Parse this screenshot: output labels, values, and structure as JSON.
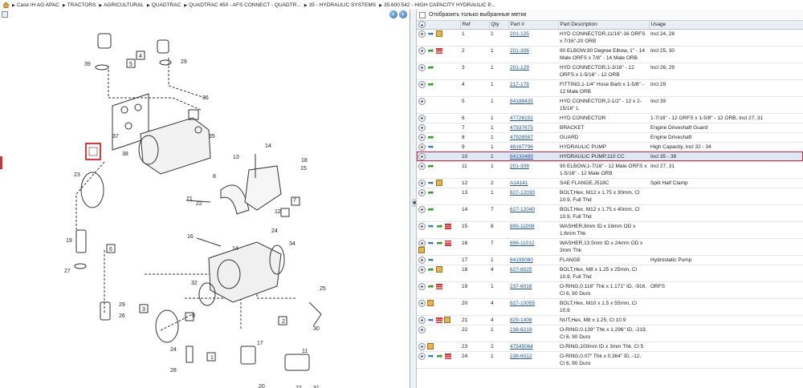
{
  "breadcrumb": [
    "Case IH AG APAC",
    "TRACTORS",
    "AGRICULTURAL",
    "QUADTRAC",
    "QUADTRAC 450 - AFS CONNECT - QUADTR...",
    "35 - HYDRAULIC SYSTEMS",
    "35.600.542 - HIGH CAPACITY HYDRAULIC P..."
  ],
  "filter_label": "Отобразить только выбранные метки",
  "columns": [
    "",
    "Ref",
    "Qty",
    "Part #",
    "Part Description",
    "Usage"
  ],
  "diagram_labels": [
    "39",
    "5",
    "4",
    "29",
    "36",
    "35",
    "37",
    "38",
    "14",
    "13",
    "18",
    "15",
    "7",
    "8",
    "12",
    "24",
    "21",
    "22",
    "23",
    "19",
    "6",
    "27",
    "16",
    "14",
    "34",
    "32",
    "9",
    "29",
    "26",
    "3",
    "2",
    "25",
    "30",
    "17",
    "11",
    "20",
    "24",
    "1",
    "28",
    "27",
    "31"
  ],
  "rows": [
    {
      "icons": [
        "plus",
        "info",
        "box"
      ],
      "ref": "1",
      "qty": "1",
      "part": "201-125",
      "desc": "HYD CONNECTOR,11/16\"-16 ORFS x 7/16\"-20 ORB",
      "usage": "Incl 24, 28"
    },
    {
      "icons": [
        "plus",
        "green",
        "red"
      ],
      "ref": "2",
      "qty": "1",
      "part": "201-306",
      "desc": "90 ELBOW,90 Degree Elbow, 1\" - 14 Male ORFS x 7/8\" - 14 Male ORB",
      "usage": "Incl 25, 30"
    },
    {
      "icons": [
        "plus",
        "green"
      ],
      "ref": "3",
      "qty": "1",
      "part": "201-129",
      "desc": "HYD CONNECTOR,1-3/16\" - 12 ORFS x 1-5/16\" - 12 ORB",
      "usage": "Incl 26, 29"
    },
    {
      "icons": [
        "plus",
        "green"
      ],
      "ref": "4",
      "qty": "1",
      "part": "217-178",
      "desc": "FITTING,1-1/4\" Hose Barb x 1-5/8\" - 12 Male ORB",
      "usage": "Incl 29"
    },
    {
      "icons": [
        "plus"
      ],
      "ref": "5",
      "qty": "1",
      "part": "84188435",
      "desc": "HYD CONNECTOR,2-1/2\" - 12 x 2-15/16\" L",
      "usage": "Incl 39"
    },
    {
      "icons": [
        "plus"
      ],
      "ref": "6",
      "qty": "1",
      "part": "47726152",
      "desc": "HYD CONNECTOR",
      "usage": "1-7/16\" - 12 ORFS x 1-5/8\" - 12 ORB, Incl 27, 31"
    },
    {
      "icons": [
        "plus"
      ],
      "ref": "7",
      "qty": "1",
      "part": "47937675",
      "desc": "BRACKET",
      "usage": "Engine Driveshaft Guard"
    },
    {
      "icons": [
        "plus",
        "green"
      ],
      "ref": "8",
      "qty": "1",
      "part": "47928587",
      "desc": "GUARD",
      "usage": "Engine Driveshaft"
    },
    {
      "icons": [
        "plus",
        "info"
      ],
      "ref": "9",
      "qty": "1",
      "part": "48167796",
      "desc": "HYDRAULIC PUMP",
      "usage": "High Capacity, Incl 32 - 34"
    },
    {
      "icons": [
        "plus"
      ],
      "ref": "10",
      "qty": "1",
      "part": "84130489",
      "desc": "HYDRAULIC PUMP,110 CC",
      "usage": "Incl 35 - 38",
      "selected": true
    },
    {
      "icons": [
        "plus",
        "green"
      ],
      "ref": "11",
      "qty": "1",
      "part": "201-308",
      "desc": "90 ELBOW,1-7/16\" - 12 Male ORFS x 1-5/16\" - 12 Male ORB",
      "usage": "Incl 27, 31"
    },
    {
      "icons": [
        "plus",
        "info",
        "box"
      ],
      "ref": "12",
      "qty": "2",
      "part": "A14141",
      "desc": "SAE FLANGE,J518C",
      "usage": "Split Half Clamp"
    },
    {
      "icons": [
        "plus",
        "green"
      ],
      "ref": "13",
      "qty": "1",
      "part": "627-12030",
      "desc": "BOLT,Hex, M12 x 1.75 x 30mm, Cl 10.9, Full Thd",
      "usage": ""
    },
    {
      "icons": [
        "plus",
        "green"
      ],
      "ref": "14",
      "qty": "7",
      "part": "627-12040",
      "desc": "BOLT,Hex, M12 x 1.75 x 40mm, Cl 10.9, Full Thd",
      "usage": ""
    },
    {
      "icons": [
        "plus",
        "info",
        "green",
        "red"
      ],
      "ref": "15",
      "qty": "8",
      "part": "895-11008",
      "desc": "WASHER,8mm ID x 16mm OD x 1.6mm Thk",
      "usage": ""
    },
    {
      "icons": [
        "plus",
        "info",
        "green",
        "red",
        "box"
      ],
      "ref": "16",
      "qty": "7",
      "part": "896-11012",
      "desc": "WASHER,13.5mm ID x 24mm OD x 3mm Thk",
      "usage": ""
    },
    {
      "icons": [
        "plus",
        "info"
      ],
      "ref": "17",
      "qty": "1",
      "part": "84195080",
      "desc": "FLANGE",
      "usage": "Hydrostatic Pump"
    },
    {
      "icons": [
        "plus",
        "green",
        "box"
      ],
      "ref": "18",
      "qty": "4",
      "part": "627-8025",
      "desc": "BOLT,Hex, M8 x 1.25 x 25mm, Cl 10.9, Full Thd",
      "usage": ""
    },
    {
      "icons": [
        "plus",
        "green",
        "red"
      ],
      "ref": "19",
      "qty": "1",
      "part": "237-6016",
      "desc": "O-RING,0.116\" Thk x 1.171\" ID, -916, Cl 6, 90 Duro",
      "usage": "ORFS"
    },
    {
      "icons": [
        "plus",
        "box"
      ],
      "ref": "20",
      "qty": "4",
      "part": "627-10055",
      "desc": "BOLT,Hex, M10 x 1.5 x 55mm, Cl 10.9",
      "usage": ""
    },
    {
      "icons": [
        "plus",
        "info",
        "red",
        "box"
      ],
      "ref": "21",
      "qty": "4",
      "part": "829-1408",
      "desc": "NUT,Hex, M8 x 1.25, Cl 10.9",
      "usage": ""
    },
    {
      "icons": [
        "plus"
      ],
      "ref": "22",
      "qty": "1",
      "part": "238-6219",
      "desc": "O-RING,0.139\" Thk x 1.296\" ID, -219, Cl 6, 90 Duro",
      "usage": ""
    },
    {
      "icons": [
        "plus",
        "box"
      ],
      "ref": "23",
      "qty": "2",
      "part": "47545064",
      "desc": "O-RING,100mm ID x 3mm Thk, Cl 5",
      "usage": ""
    },
    {
      "icons": [
        "plus",
        "info",
        "green",
        "red"
      ],
      "ref": "24",
      "qty": "1",
      "part": "238-6012",
      "desc": "O-RING,0.07\" Thk x 0.364\" ID, -12, Cl 6, 90 Duro",
      "usage": ""
    }
  ]
}
